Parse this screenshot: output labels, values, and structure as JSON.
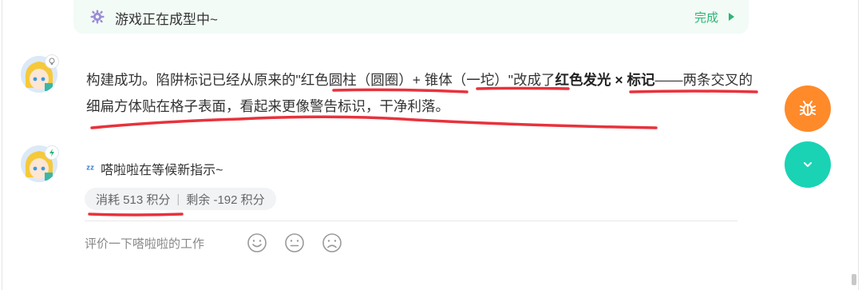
{
  "status_card": {
    "title": "游戏正在成型中~",
    "done_label": "完成"
  },
  "message": {
    "p1": "构建成功。陷阱标记已经从原来的\"红色圆柱（圆圈）+ 锥体（一坨）\"改成了",
    "bold": "红色发光 × 标记",
    "p2": "——两条交叉的细扁方体贴在格子表面，看起来更像警告标识，干净利落。"
  },
  "idle": {
    "icon": "zzz-icon",
    "text": "嗒啦啦在等候新指示~"
  },
  "credits": {
    "consumed": "消耗 513 积分",
    "separator": "|",
    "remaining": "剩余 -192 积分"
  },
  "rating": {
    "prompt": "评价一下嗒啦啦的工作",
    "faces": [
      "smile-face-icon",
      "neutral-face-icon",
      "sad-face-icon"
    ]
  },
  "fabs": {
    "bug_label": "bug-icon",
    "scroll_icon": "chevron-down-icon"
  },
  "colors": {
    "accent_green": "#2bb673",
    "fab_orange": "#ff8a2a",
    "fab_teal": "#19d3b4",
    "annotation_red": "#e8323c"
  }
}
